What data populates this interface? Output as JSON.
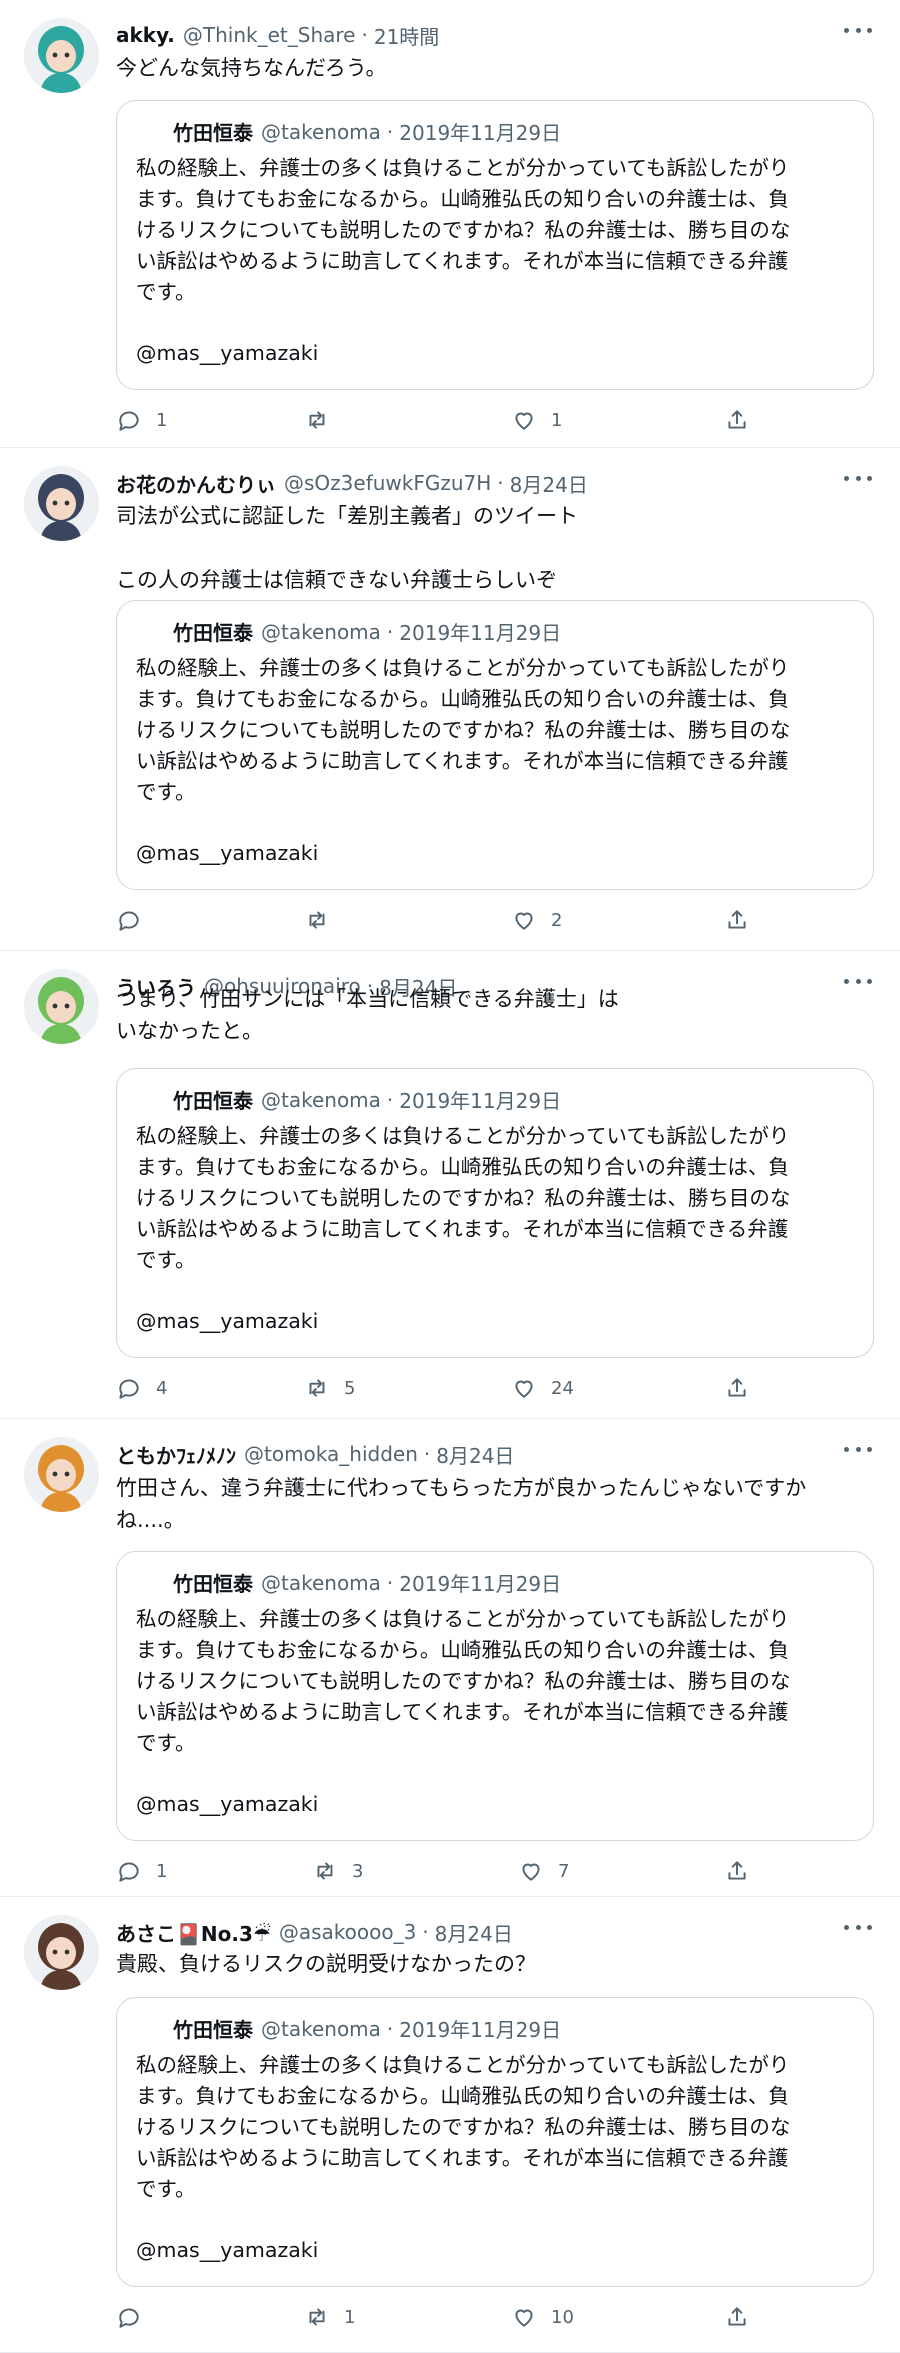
{
  "tweets": [
    {
      "name": "akky.",
      "handle": "@Think_et_Share",
      "separator": "·",
      "time": "21時間",
      "text": [
        "今どんな気持ちなんだろう。"
      ],
      "replies": "1",
      "retweets": "",
      "likes": "1",
      "avatar_color": "#2ea7a0"
    },
    {
      "name": "お花のかんむりぃ",
      "handle": "@sOz3efuwkFGzu7H",
      "separator": "·",
      "time": "8月24日",
      "text": [
        "司法が公式に認証した「差別主義者」のツイート",
        "",
        "この人の弁護士は信頼できない弁護士らしいぞ"
      ],
      "replies": "",
      "retweets": "",
      "likes": "2",
      "avatar_color": "#3a4660"
    },
    {
      "name": "ういろう",
      "handle": "@ohsuuironairo",
      "separator": "·",
      "time": "8月24日",
      "text": [
        "つまり、竹田サンには「本当に信頼できる弁護士」は",
        "いなかったと。"
      ],
      "replies": "4",
      "retweets": "5",
      "likes": "24",
      "avatar_color": "#6fbf5a"
    },
    {
      "name": "ともかﾌｪﾉﾒﾉﾝ",
      "handle": "@tomoka_hidden",
      "separator": "·",
      "time": "8月24日",
      "text": [
        "竹田さん、違う弁護士に代わってもらった方が良かったんじゃないですか",
        "ね....。"
      ],
      "replies": "1",
      "retweets": "3",
      "likes": "7",
      "avatar_color": "#e0902f"
    },
    {
      "name": "あさこ🎴No.3☔",
      "handle": "@asakoooo_3",
      "separator": "·",
      "time": "8月24日",
      "text": [
        "貴殿、負けるリスクの説明受けなかったの？"
      ],
      "replies": "",
      "retweets": "1",
      "likes": "10",
      "avatar_color": "#5a3b2e"
    }
  ],
  "quoted": {
    "name": "竹田恒泰",
    "handle": "@takenoma",
    "separator": "·",
    "date": "2019年11月29日",
    "lines": [
      "私の経験上、弁護士の多くは負けることが分かっていても訴訟したがり",
      "ます。負けてもお金になるから。山崎雅弘氏の知り合いの弁護士は、負",
      "けるリスクについても説明したのですかね？私の弁護士は、勝ち目のな",
      "い訴訟はやめるように助言してくれます。それが本当に信頼できる弁護",
      "です。"
    ],
    "mention": "@mas__yamazaki"
  },
  "icons": [
    "reply-icon",
    "retweet-icon",
    "like-icon",
    "share-icon",
    "more-icon"
  ],
  "colors": {
    "text": "#0f1419",
    "muted": "#536471",
    "border": "#cfd9de"
  }
}
